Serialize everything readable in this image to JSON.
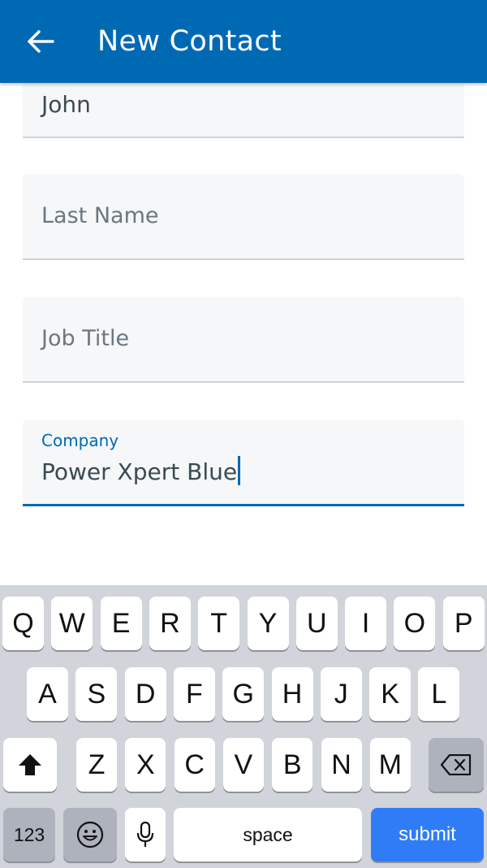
{
  "app_bar": {
    "title": "New Contact",
    "back_icon": "arrow-left-icon",
    "color": "#0069b4"
  },
  "form": {
    "first_name": {
      "value": "John"
    },
    "last_name": {
      "placeholder": "Last Name",
      "value": ""
    },
    "job_title": {
      "placeholder": "Job Title",
      "value": ""
    },
    "company": {
      "label": "Company",
      "value": "Power Xpert Blue",
      "focused": true
    }
  },
  "keyboard": {
    "row1": [
      "Q",
      "W",
      "E",
      "R",
      "T",
      "Y",
      "U",
      "I",
      "O",
      "P"
    ],
    "row2": [
      "A",
      "S",
      "D",
      "F",
      "G",
      "H",
      "J",
      "K",
      "L"
    ],
    "row3": [
      "Z",
      "X",
      "C",
      "V",
      "B",
      "N",
      "M"
    ],
    "shift_icon": "shift-arrow-icon",
    "backspace_icon": "backspace-icon",
    "numbers_label": "123",
    "emoji_icon": "emoji-icon",
    "mic_icon": "microphone-icon",
    "space_label": "space",
    "submit_label": "submit",
    "submit_color": "#2f7cf6"
  }
}
